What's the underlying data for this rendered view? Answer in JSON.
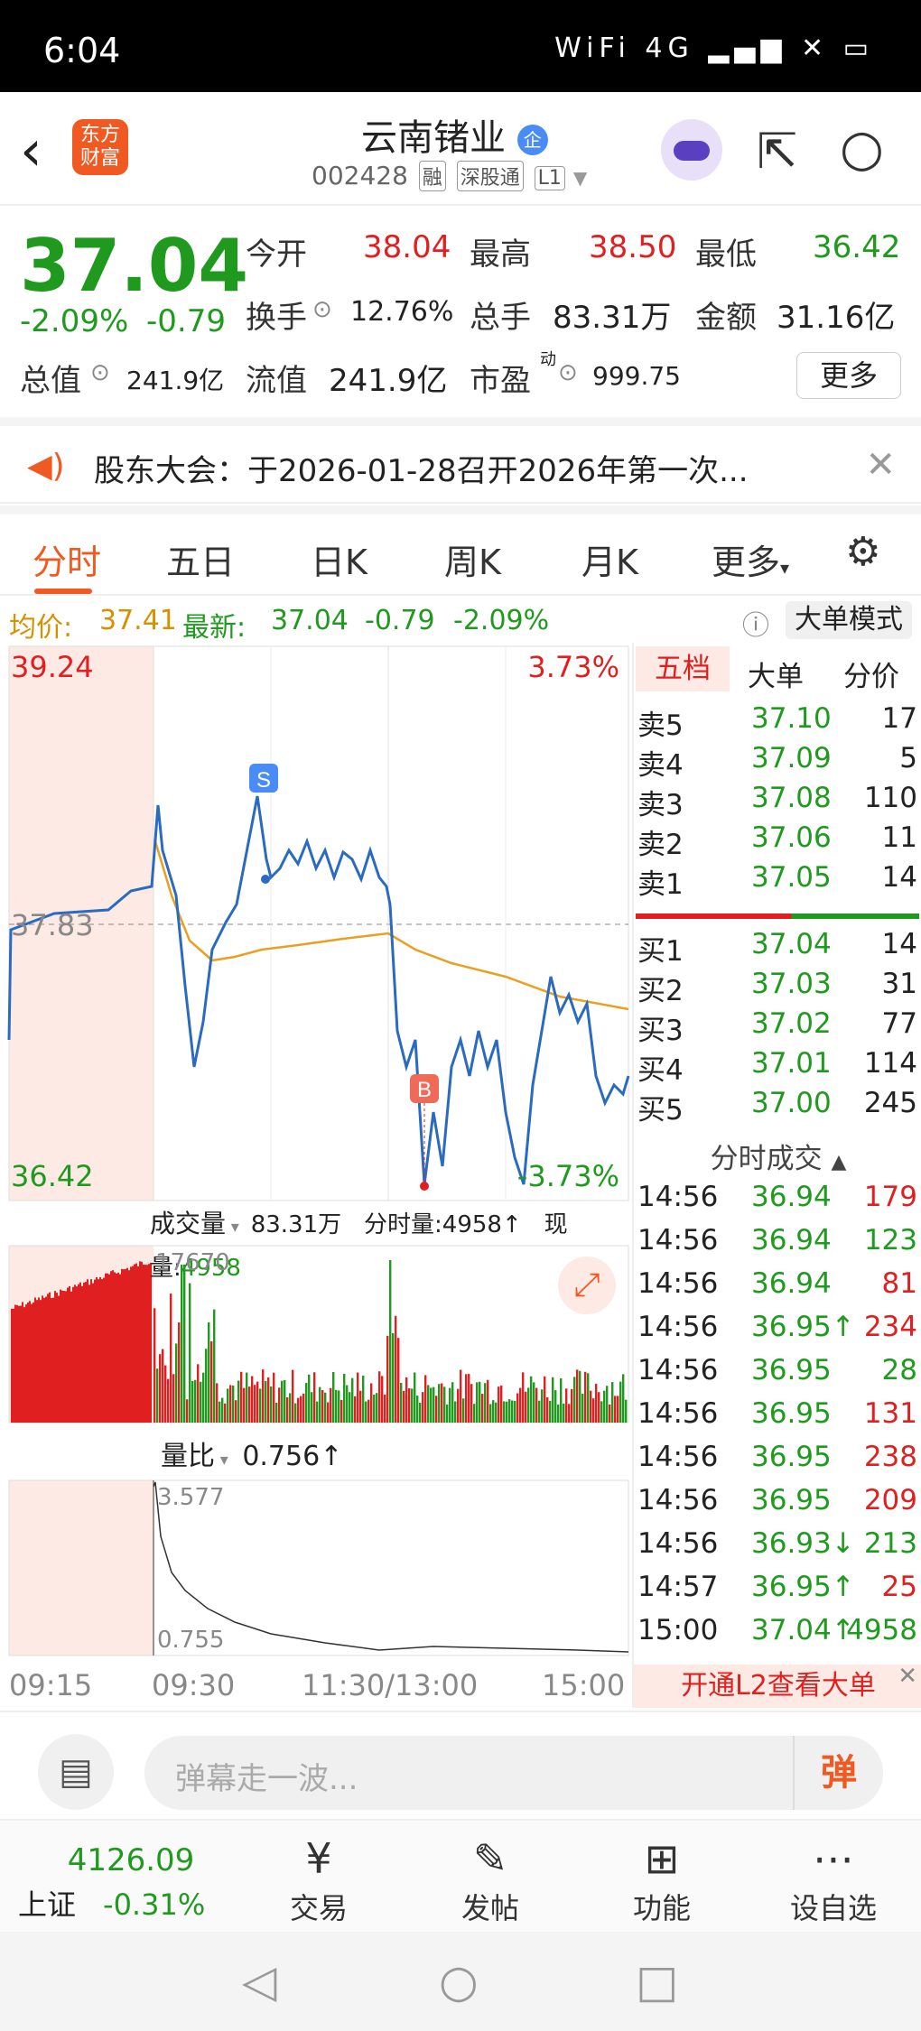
{
  "status_bar": {
    "time": "6:04",
    "icons": "WiFi 4G ▂▄▆ ✕ ▭"
  },
  "header": {
    "logo_line1": "东方",
    "logo_line2": "财富",
    "stock_name": "云南锗业",
    "badge": "企",
    "code": "002428",
    "tags": [
      "融",
      "深股通",
      "L1"
    ]
  },
  "quote": {
    "price": "37.04",
    "change_pct": "-2.09%",
    "change": "-0.79",
    "open_label": "今开",
    "open": "38.04",
    "high_label": "最高",
    "high": "38.50",
    "low_label": "最低",
    "low": "36.42",
    "turnover_label": "换手",
    "turnover": "12.76%",
    "volume_label": "总手",
    "volume": "83.31万",
    "amount_label": "金额",
    "amount": "31.16亿",
    "mktcap_label": "总值",
    "mktcap": "241.9亿",
    "float_label": "流值",
    "float_cap": "241.9亿",
    "pe_label": "市盈",
    "pe_sup": "动",
    "pe": "999.75",
    "more": "更多"
  },
  "notice": {
    "text": "股东大会：于2026-01-28召开2026年第一次..."
  },
  "tabs": [
    "分时",
    "五日",
    "日K",
    "周K",
    "月K",
    "更多"
  ],
  "avg": {
    "avg_label": "均价:",
    "avg": "37.41",
    "latest_label": "最新:",
    "latest": "37.04",
    "chg": "-0.79",
    "pct": "-2.09%",
    "mode_btn": "大单模式"
  },
  "chart": {
    "y_max": "39.24",
    "y_mid": "37.83",
    "y_min": "36.42",
    "pct_max": "3.73%",
    "pct_min": "-3.73%",
    "volume_label": "成交量",
    "volume_total": "83.31万",
    "period_vol": "分时量:4958↑",
    "now_label": "现量:",
    "now_vol": "4958",
    "vol_max": "17670",
    "ratio_label": "量比",
    "ratio": "0.756↑",
    "ratio_max": "3.577",
    "ratio_min": "0.755",
    "times": [
      "09:15",
      "09:30",
      "11:30/13:00",
      "15:00"
    ],
    "marker_s": "S",
    "marker_b": "B"
  },
  "book": {
    "tabs": [
      "五档",
      "大单",
      "分价"
    ],
    "asks": [
      {
        "label": "卖5",
        "price": "37.10",
        "vol": "17"
      },
      {
        "label": "卖4",
        "price": "37.09",
        "vol": "5"
      },
      {
        "label": "卖3",
        "price": "37.08",
        "vol": "110"
      },
      {
        "label": "卖2",
        "price": "37.06",
        "vol": "11"
      },
      {
        "label": "卖1",
        "price": "37.05",
        "vol": "14"
      }
    ],
    "bids": [
      {
        "label": "买1",
        "price": "37.04",
        "vol": "14"
      },
      {
        "label": "买2",
        "price": "37.03",
        "vol": "31"
      },
      {
        "label": "买3",
        "price": "37.02",
        "vol": "77"
      },
      {
        "label": "买4",
        "price": "37.01",
        "vol": "114"
      },
      {
        "label": "买5",
        "price": "37.00",
        "vol": "245"
      }
    ],
    "ticks_title": "分时成交",
    "ticks": [
      {
        "time": "14:56",
        "price": "36.94",
        "vol": "179",
        "color": "red"
      },
      {
        "time": "14:56",
        "price": "36.94",
        "vol": "123",
        "color": "green"
      },
      {
        "time": "14:56",
        "price": "36.94",
        "vol": "81",
        "color": "red"
      },
      {
        "time": "14:56",
        "price": "36.95↑",
        "vol": "234",
        "color": "red"
      },
      {
        "time": "14:56",
        "price": "36.95",
        "vol": "28",
        "color": "green"
      },
      {
        "time": "14:56",
        "price": "36.95",
        "vol": "131",
        "color": "red"
      },
      {
        "time": "14:56",
        "price": "36.95",
        "vol": "238",
        "color": "red"
      },
      {
        "time": "14:56",
        "price": "36.95",
        "vol": "209",
        "color": "red"
      },
      {
        "time": "14:56",
        "price": "36.93↓",
        "vol": "213",
        "color": "green"
      },
      {
        "time": "14:57",
        "price": "36.95↑",
        "vol": "25",
        "color": "red"
      },
      {
        "time": "15:00",
        "price": "37.04↑",
        "vol": "4958",
        "color": "green"
      }
    ],
    "l2_banner": "开通L2查看大单"
  },
  "danmu": {
    "placeholder": "弹幕走一波...",
    "btn": "弹"
  },
  "nav": {
    "index_value": "4126.09",
    "index_name": "上证",
    "index_pct": "-0.31%",
    "items": [
      "交易",
      "发帖",
      "功能",
      "设自选"
    ]
  }
}
